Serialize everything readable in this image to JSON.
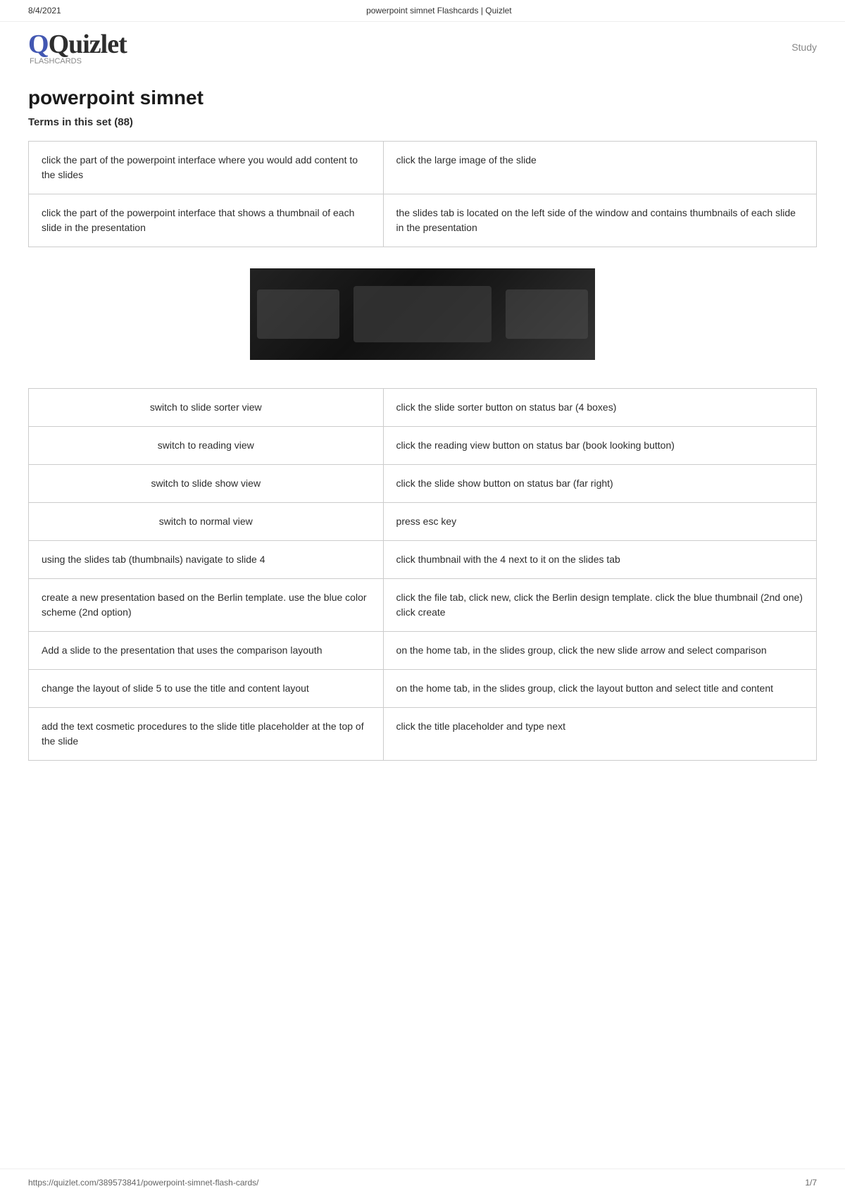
{
  "browser": {
    "date": "8/4/2021",
    "page_title": "powerpoint simnet Flashcards | Quizlet",
    "url": "https://quizlet.com/389573841/powerpoint-simnet-flash-cards/",
    "page_number": "1/7"
  },
  "header": {
    "logo_text": "Quizlet",
    "logo_sub": "FLASHCARDS",
    "study_label": "Study"
  },
  "main": {
    "title": "powerpoint simnet",
    "terms_heading": "Terms in this set (88)"
  },
  "top_cards": [
    {
      "term": "click the part of the powerpoint interface where you would add content to the slides",
      "definition": "click the large image of the slide"
    },
    {
      "term": "click the part of the powerpoint interface that shows a thumbnail of each slide in the presentation",
      "definition": "the slides tab is located on the left side of the window and contains thumbnails of each slide in the presentation"
    }
  ],
  "bottom_cards": [
    {
      "term": "switch to slide sorter view",
      "definition": "click the slide sorter button on status bar (4 boxes)",
      "centered": true
    },
    {
      "term": "switch to reading view",
      "definition": "click the reading view button on status bar (book looking button)",
      "centered": true
    },
    {
      "term": "switch to slide show view",
      "definition": "click the slide show button on status bar (far right)",
      "centered": true
    },
    {
      "term": "switch to normal view",
      "definition": "press esc key",
      "centered": true
    },
    {
      "term": "using the slides tab (thumbnails) navigate to slide 4",
      "definition": "click thumbnail with the 4 next to it on the slides tab",
      "centered": false
    },
    {
      "term": "create a new presentation based on the Berlin template. use the blue color scheme (2nd option)",
      "definition": "click the file tab, click new, click the Berlin design template. click the blue thumbnail (2nd one) click create",
      "centered": false
    },
    {
      "term": "Add a slide to the presentation that uses the comparison layouth",
      "definition": "on the home tab, in the slides group, click the new slide arrow and select comparison",
      "centered": false
    },
    {
      "term": "change the layout of slide 5 to use the title and content layout",
      "definition": "on the home tab, in the slides group, click the layout button and select title and content",
      "centered": false
    },
    {
      "term": "add the text cosmetic procedures to the slide title placeholder at the top of the slide",
      "definition": "click the title placeholder and type next",
      "centered": false
    }
  ]
}
